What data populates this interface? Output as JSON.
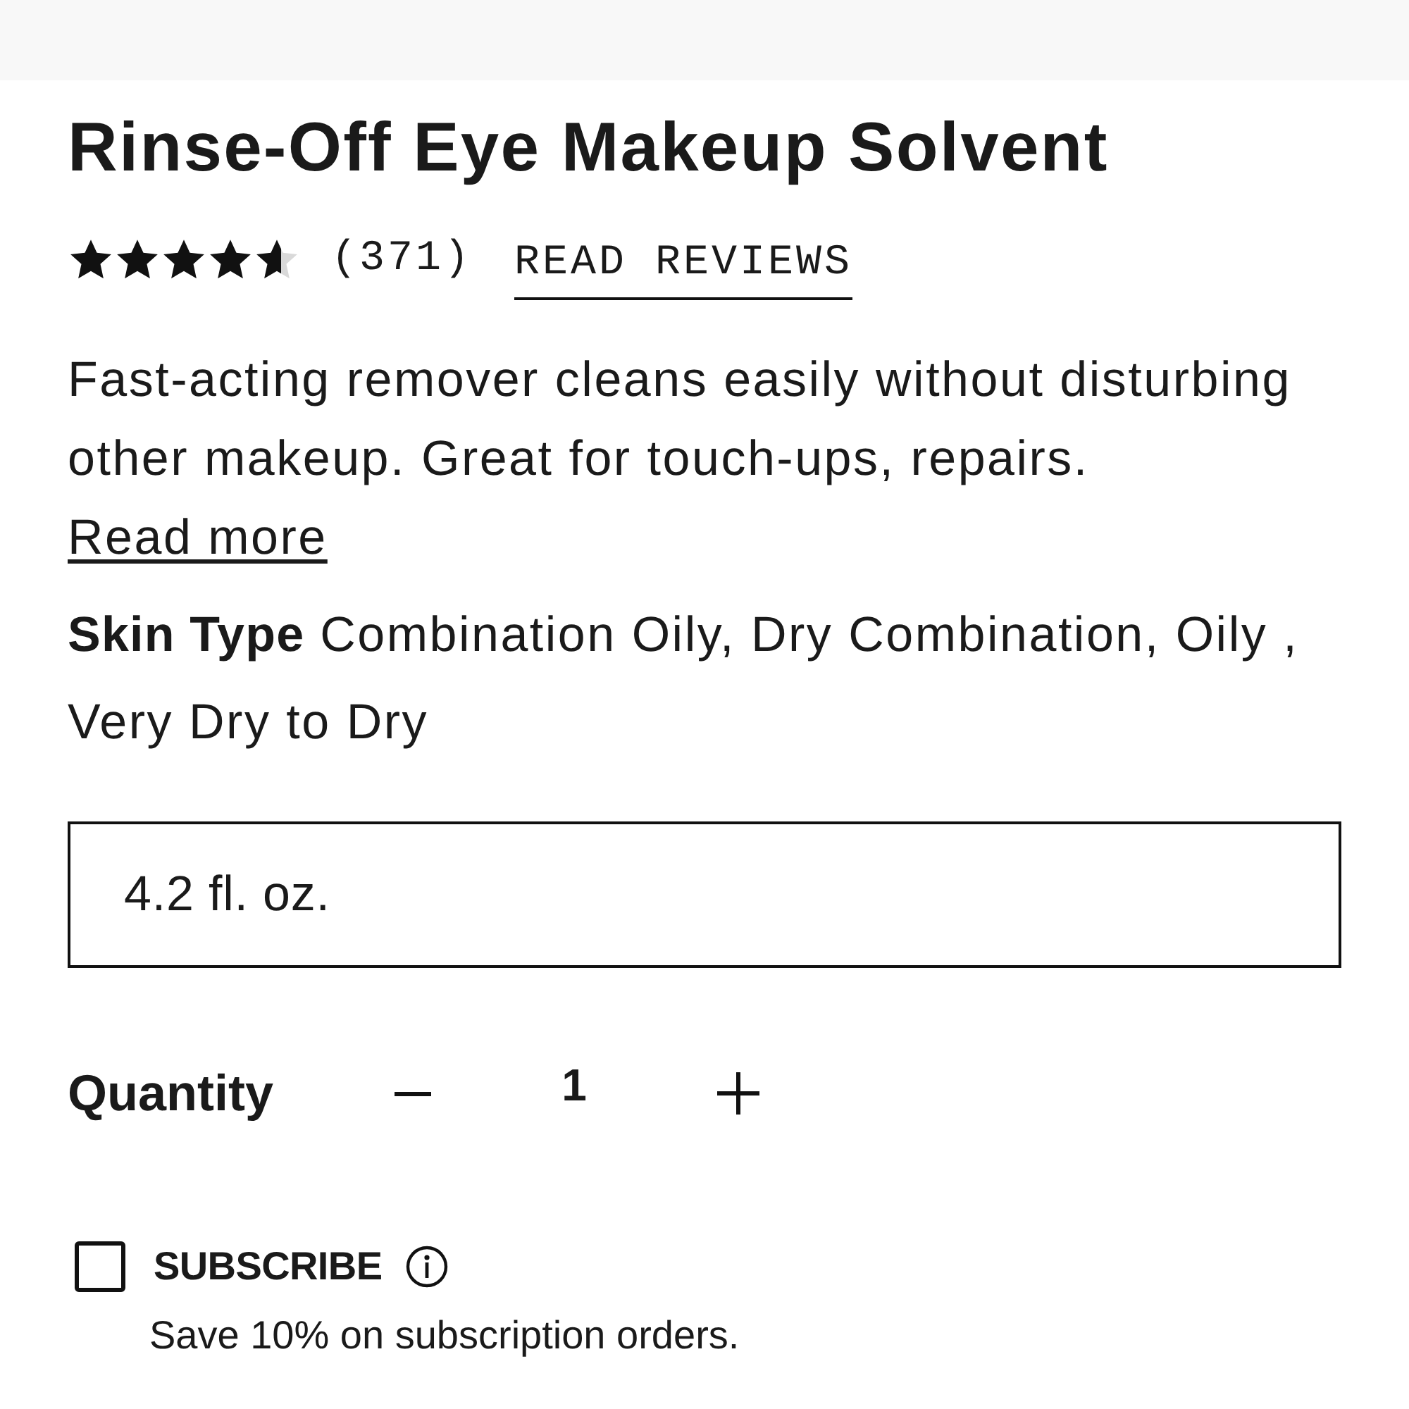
{
  "product": {
    "title": "Rinse-Off Eye Makeup Solvent",
    "rating": {
      "stars": 4.6,
      "count": "(371)",
      "reviews_link": "READ REVIEWS"
    },
    "description": {
      "text": "Fast-acting remover cleans easily without disturbing other makeup. Great for touch-ups, repairs.",
      "link": "Read more"
    },
    "skin_type": {
      "label": "Skin Type",
      "value": "Combination Oily, Dry Combination, Oily , Very Dry to Dry"
    },
    "size_option": {
      "label": "4.2 fl. oz."
    },
    "quantity": {
      "label": "Quantity",
      "value": "1"
    },
    "subscribe": {
      "label": "SUBSCRIBE",
      "checked": false,
      "note": "Save 10% on subscription orders."
    }
  }
}
